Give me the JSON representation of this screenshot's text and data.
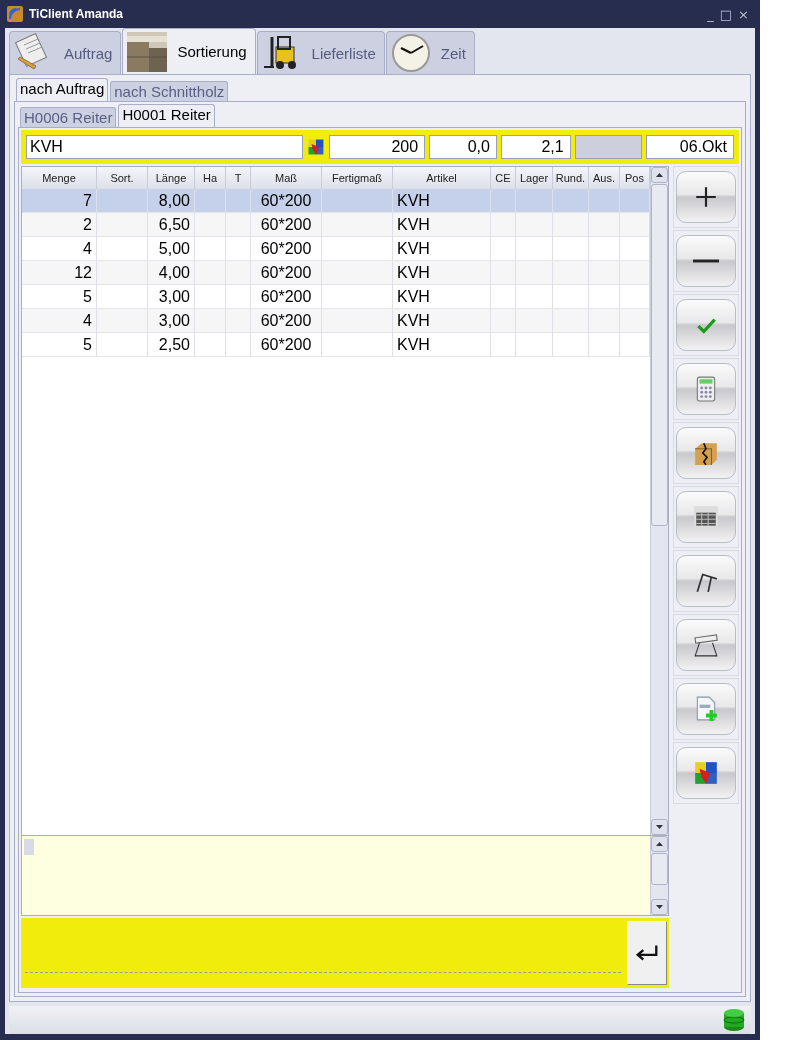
{
  "window": {
    "title": "TiClient Amanda",
    "controls": [
      "_",
      "□",
      "×"
    ]
  },
  "tabs": [
    {
      "label": "Auftrag",
      "selected": false
    },
    {
      "label": "Sortierung",
      "selected": true
    },
    {
      "label": "Lieferliste",
      "selected": false
    },
    {
      "label": "Zeit",
      "selected": false
    }
  ],
  "subtabs": [
    {
      "label": "nach Auftrag",
      "selected": true
    },
    {
      "label": "nach Schnittholz",
      "selected": false
    }
  ],
  "reiter_tabs": [
    {
      "label": "H0006 Reiter",
      "selected": false
    },
    {
      "label": "H0001 Reiter",
      "selected": true
    }
  ],
  "header": {
    "article": "KVH",
    "fields": [
      {
        "value": "200",
        "disabled": false
      },
      {
        "value": "0,0",
        "disabled": false
      },
      {
        "value": "2,1",
        "disabled": false
      },
      {
        "disabled": true
      },
      {
        "value": "06.Okt",
        "disabled": false
      }
    ]
  },
  "table": {
    "columns": [
      "Menge",
      "Sort.",
      "Länge",
      "Ha",
      "T",
      "Maß",
      "Fertigmaß",
      "Artikel",
      "CE",
      "Lager",
      "Rund.",
      "Aus.",
      "Pos"
    ],
    "rows": [
      {
        "selected": true,
        "cells": [
          "7",
          null,
          "8,00",
          null,
          null,
          "60*200",
          null,
          "KVH",
          null,
          null,
          null,
          null,
          null
        ]
      },
      {
        "selected": false,
        "cells": [
          "2",
          null,
          "6,50",
          null,
          null,
          "60*200",
          null,
          "KVH",
          null,
          null,
          null,
          null,
          null
        ]
      },
      {
        "selected": false,
        "cells": [
          "4",
          null,
          "5,00",
          null,
          null,
          "60*200",
          null,
          "KVH",
          null,
          null,
          null,
          null,
          null
        ]
      },
      {
        "selected": false,
        "cells": [
          "12",
          null,
          "4,00",
          null,
          null,
          "60*200",
          null,
          "KVH",
          null,
          null,
          null,
          null,
          null
        ]
      },
      {
        "selected": false,
        "cells": [
          "5",
          null,
          "3,00",
          null,
          null,
          "60*200",
          null,
          "KVH",
          null,
          null,
          null,
          null,
          null
        ]
      },
      {
        "selected": false,
        "cells": [
          "4",
          null,
          "3,00",
          null,
          null,
          "60*200",
          null,
          "KVH",
          null,
          null,
          null,
          null,
          null
        ]
      },
      {
        "selected": false,
        "cells": [
          "5",
          null,
          "2,50",
          null,
          null,
          "60*200",
          null,
          "KVH",
          null,
          null,
          null,
          null,
          null
        ]
      }
    ]
  }
}
